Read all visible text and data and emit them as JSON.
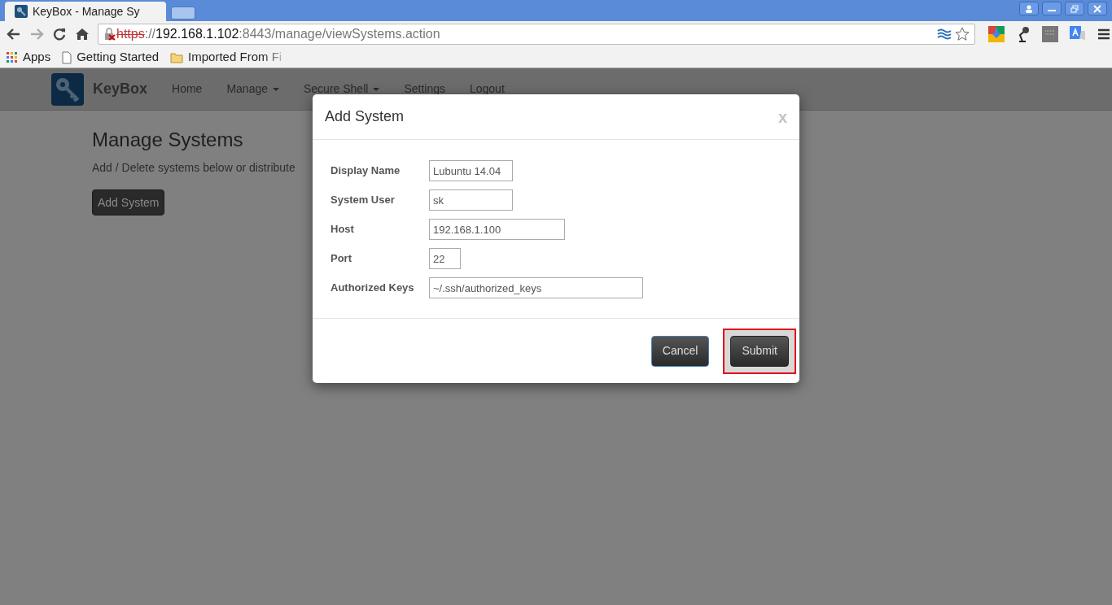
{
  "browser": {
    "tab": {
      "title": "KeyBox - Manage Sy"
    },
    "url": {
      "scheme": "https",
      "sep": "://",
      "host": "192.168.1.102",
      "rest": ":8443/manage/viewSystems.action",
      "insecure": true
    },
    "bookmarks": [
      {
        "label": "Apps",
        "kind": "apps"
      },
      {
        "label": "Getting Started",
        "kind": "page"
      },
      {
        "label": "Imported From Fi",
        "kind": "folder"
      }
    ]
  },
  "navbar": {
    "brand": "KeyBox",
    "items": [
      {
        "label": "Home",
        "dropdown": false
      },
      {
        "label": "Manage",
        "dropdown": true
      },
      {
        "label": "Secure Shell",
        "dropdown": true
      },
      {
        "label": "Settings",
        "dropdown": false
      },
      {
        "label": "Logout",
        "dropdown": false
      }
    ]
  },
  "page": {
    "title": "Manage Systems",
    "description": "Add / Delete systems below or distribute",
    "button": "Add System"
  },
  "modal": {
    "title": "Add System",
    "close": "x",
    "fields": [
      {
        "label": "Display Name",
        "value": "Lubuntu 14.04"
      },
      {
        "label": "System User",
        "value": "sk"
      },
      {
        "label": "Host",
        "value": "192.168.1.100"
      },
      {
        "label": "Port",
        "value": "22"
      },
      {
        "label": "Authorized Keys",
        "value": "~/.ssh/authorized_keys"
      }
    ],
    "buttons": [
      {
        "label": "Cancel",
        "highlighted": false
      },
      {
        "label": "Submit",
        "highlighted": true
      }
    ]
  }
}
